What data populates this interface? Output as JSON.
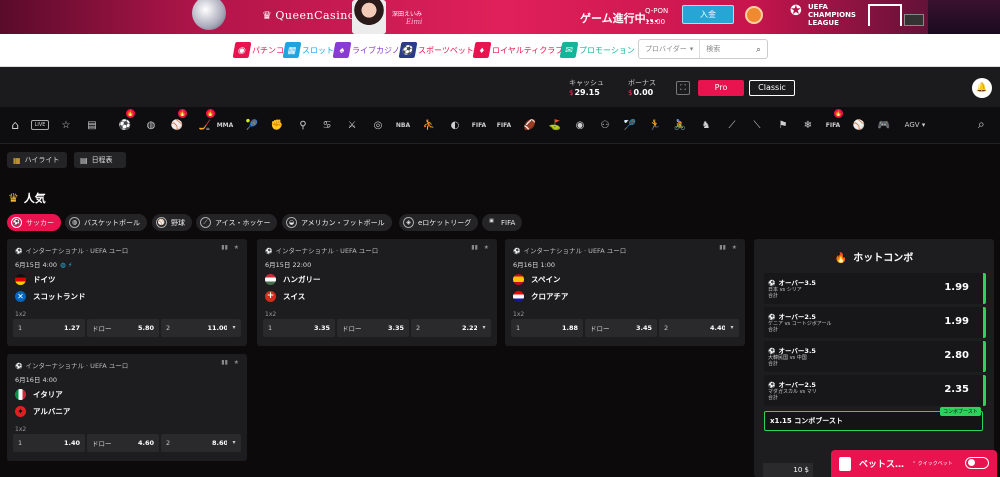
{
  "banner": {
    "logo": "QueenCasino",
    "ambassador_name": "深田えいみ",
    "ambassador_sign": "Eimi",
    "game_text": "ゲーム進行中...",
    "qpon_label": "Q-PON",
    "qpon_value": "15.00",
    "deposit_label": "入金",
    "ucl_line1": "UEFA",
    "ucl_line2": "CHAMPIONS",
    "ucl_line3": "LEAGUE"
  },
  "nav": {
    "items": [
      {
        "label": "パチンコ",
        "color": "#e8134f",
        "icon": "pachinko-icon"
      },
      {
        "label": "スロット",
        "color": "#1ea4e0",
        "icon": "slot-icon"
      },
      {
        "label": "ライブカジノ",
        "color": "#8a3bd1",
        "icon": "live-casino-icon"
      },
      {
        "label": "スポーツベット",
        "color": "#2b3b8a",
        "icon": "sportsbet-icon"
      },
      {
        "label": "ロイヤルティクラブ",
        "color": "#e8134f",
        "icon": "loyalty-club-icon"
      },
      {
        "label": "プロモーション",
        "color": "#16b59a",
        "icon": "promotion-icon"
      }
    ],
    "search_provider": "プロバイダー",
    "search_placeholder": "検索"
  },
  "account": {
    "cash_label": "キャッシュ",
    "cash_currency": "$",
    "cash_value": "29.15",
    "bonus_label": "ボーナス",
    "bonus_currency": "$",
    "bonus_value": "0.00",
    "pro_label": "Pro",
    "classic_label": "Classic"
  },
  "sports_bar": {
    "live_label": "LIVE",
    "fifa_label": "FIFA",
    "mma_label": "MMA",
    "nba_label": "NBA",
    "agv_label": "AGV"
  },
  "tabs": {
    "highlight": "ハイライト",
    "schedule": "日程表"
  },
  "popular": {
    "title": "人気",
    "chips": [
      "サッカー",
      "バスケットボール",
      "野球",
      "アイス・ホッケー",
      "アメリカン・フットボール",
      "eロケットリーグ",
      "FIFA"
    ]
  },
  "matches": [
    {
      "league": "インターナショナル · UEFA ユーロ",
      "date": "6月15日 4:00",
      "team1": "ドイツ",
      "team2": "スコットランド",
      "market": "1x2",
      "o1": "1.27",
      "ox_label": "ドロー",
      "ox": "5.80",
      "o2": "11.00",
      "l1": "1",
      "l2": "2"
    },
    {
      "league": "インターナショナル · UEFA ユーロ",
      "date": "6月15日 22:00",
      "team1": "ハンガリー",
      "team2": "スイス",
      "market": "1x2",
      "o1": "3.35",
      "ox_label": "ドロー",
      "ox": "3.35",
      "o2": "2.22",
      "l1": "1",
      "l2": "2"
    },
    {
      "league": "インターナショナル · UEFA ユーロ",
      "date": "6月16日 1:00",
      "team1": "スペイン",
      "team2": "クロアチア",
      "market": "1x2",
      "o1": "1.88",
      "ox_label": "ドロー",
      "ox": "3.45",
      "o2": "4.40",
      "l1": "1",
      "l2": "2"
    },
    {
      "league": "インターナショナル · UEFA ユーロ",
      "date": "6月16日 4:00",
      "team1": "イタリア",
      "team2": "アルバニア",
      "market": "1x2",
      "o1": "1.40",
      "ox_label": "ドロー",
      "ox": "4.60",
      "o2": "8.60",
      "l1": "1",
      "l2": "2"
    }
  ],
  "hot_combo": {
    "title": "ホットコンボ",
    "items": [
      {
        "title": "オーバー3.5",
        "match": "日本 vs シリア",
        "type": "合計",
        "odds": "1.99"
      },
      {
        "title": "オーバー2.5",
        "match": "ケニア vs コートジボアール",
        "type": "合計",
        "odds": "1.99"
      },
      {
        "title": "オーバー3.5",
        "match": "大韓民国 vs 中国",
        "type": "合計",
        "odds": "2.80"
      },
      {
        "title": "オーバー2.5",
        "match": "マダガスカル vs マリ",
        "type": "合計",
        "odds": "2.35"
      }
    ],
    "boost_label": "x1.15 コンボブースト",
    "boost_tag": "コンボブースト",
    "stake": "10 $"
  },
  "betslip": {
    "label": "ベットス…",
    "quick": "クイックベット"
  }
}
